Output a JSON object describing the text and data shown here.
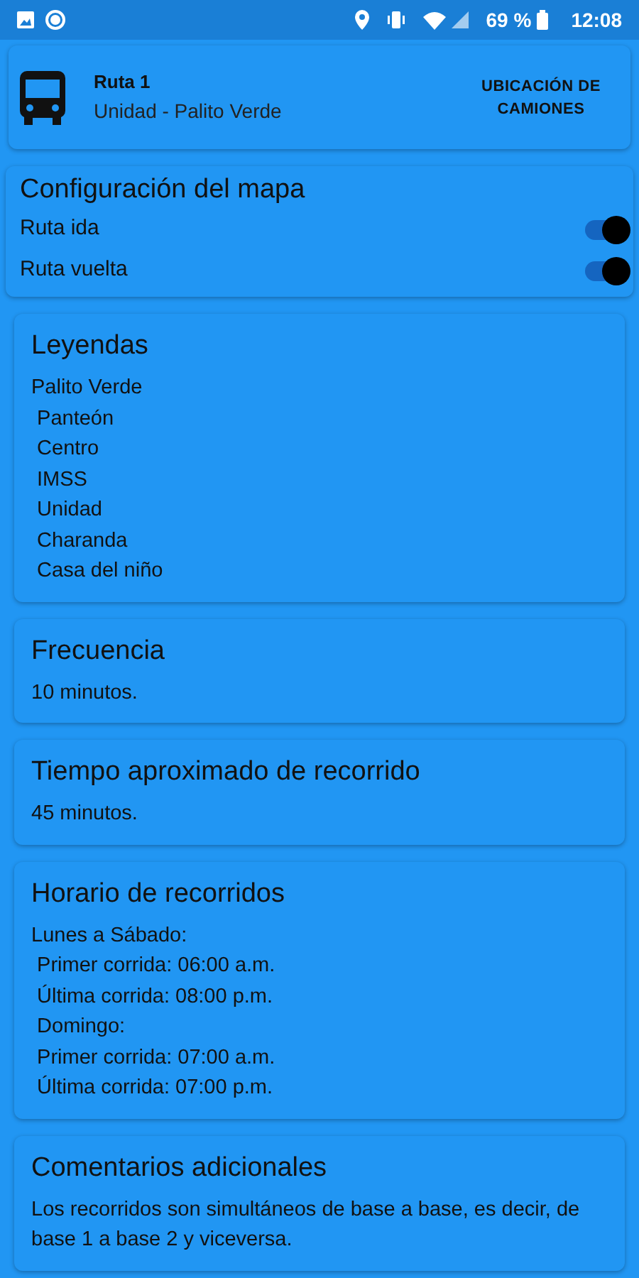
{
  "status_bar": {
    "battery": "69 %",
    "time": "12:08"
  },
  "header": {
    "title": "Ruta 1",
    "subtitle": "Unidad - Palito Verde",
    "action": "UBICACIÓN DE CAMIONES"
  },
  "map_config": {
    "title": "Configuración del mapa",
    "toggles": [
      {
        "label": "Ruta ida",
        "on": true
      },
      {
        "label": "Ruta vuelta",
        "on": true
      }
    ]
  },
  "sections": [
    {
      "title": "Leyendas",
      "lines": [
        "Palito Verde",
        " Panteón",
        " Centro",
        " IMSS",
        " Unidad",
        " Charanda",
        " Casa del niño"
      ]
    },
    {
      "title": "Frecuencia",
      "lines": [
        "10 minutos."
      ]
    },
    {
      "title": "Tiempo aproximado de recorrido",
      "lines": [
        "45 minutos."
      ]
    },
    {
      "title": "Horario de recorridos",
      "lines": [
        "Lunes a Sábado:",
        " Primer corrida: 06:00 a.m.",
        " Última corrida: 08:00 p.m.",
        " Domingo:",
        " Primer corrida: 07:00 a.m.",
        " Última corrida: 07:00 p.m."
      ]
    },
    {
      "title": "Comentarios adicionales",
      "lines": [
        "Los recorridos son simultáneos de base a base, es decir, de base 1 a base 2 y viceversa."
      ]
    }
  ]
}
